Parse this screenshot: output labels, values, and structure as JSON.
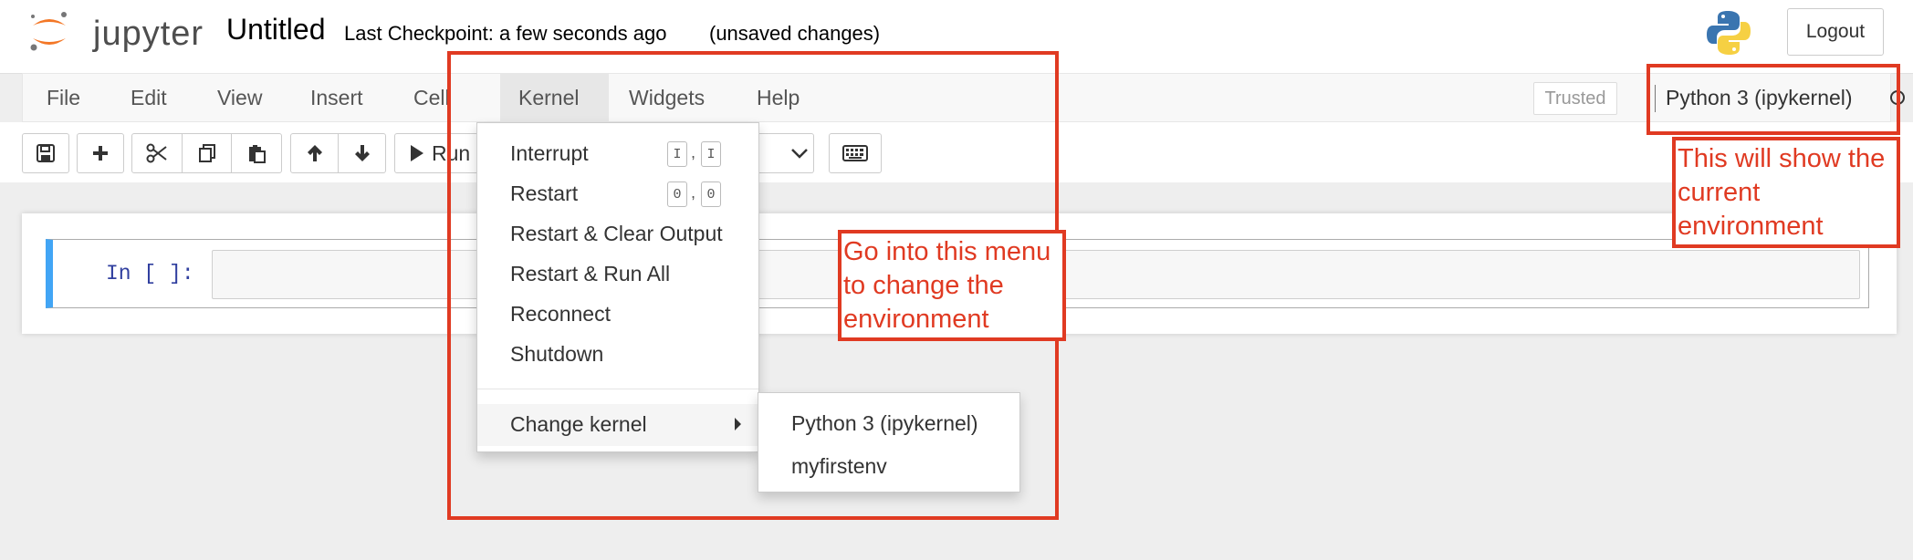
{
  "header": {
    "logo_text": "jupyter",
    "notebook_title": "Untitled",
    "checkpoint": "Last Checkpoint: a few seconds ago",
    "unsaved": "(unsaved changes)",
    "logout_label": "Logout"
  },
  "menubar": {
    "items": [
      "File",
      "Edit",
      "View",
      "Insert",
      "Cell",
      "Kernel",
      "Widgets",
      "Help"
    ],
    "open_menu": "Kernel",
    "trusted_label": "Trusted",
    "kernel_name": "Python 3 (ipykernel)"
  },
  "toolbar": {
    "run_label": "Run",
    "buttons": [
      "save-icon",
      "plus-icon",
      "cut-icon",
      "copy-icon",
      "paste-icon",
      "arrow-up-icon",
      "arrow-down-icon",
      "run-icon",
      "keyboard-icon"
    ]
  },
  "cell": {
    "prompt": "In [ ]:",
    "input": ""
  },
  "kernel_menu": {
    "items": [
      {
        "label": "Interrupt",
        "shortcut": [
          "I",
          "I"
        ]
      },
      {
        "label": "Restart",
        "shortcut": [
          "0",
          "0"
        ]
      },
      {
        "label": "Restart & Clear Output"
      },
      {
        "label": "Restart & Run All"
      },
      {
        "label": "Reconnect"
      },
      {
        "label": "Shutdown"
      },
      {
        "label": "Change kernel"
      }
    ],
    "submenu": [
      "Python 3 (ipykernel)",
      "myfirstenv"
    ]
  },
  "annotations": {
    "menu_note": "Go into this menu to change the environment",
    "kernel_note": "This will show the current environment",
    "color": "#e03a22"
  },
  "colors": {
    "accent": "#42a5f5",
    "logo_orange": "#f37726",
    "prompt": "#303f9f"
  }
}
